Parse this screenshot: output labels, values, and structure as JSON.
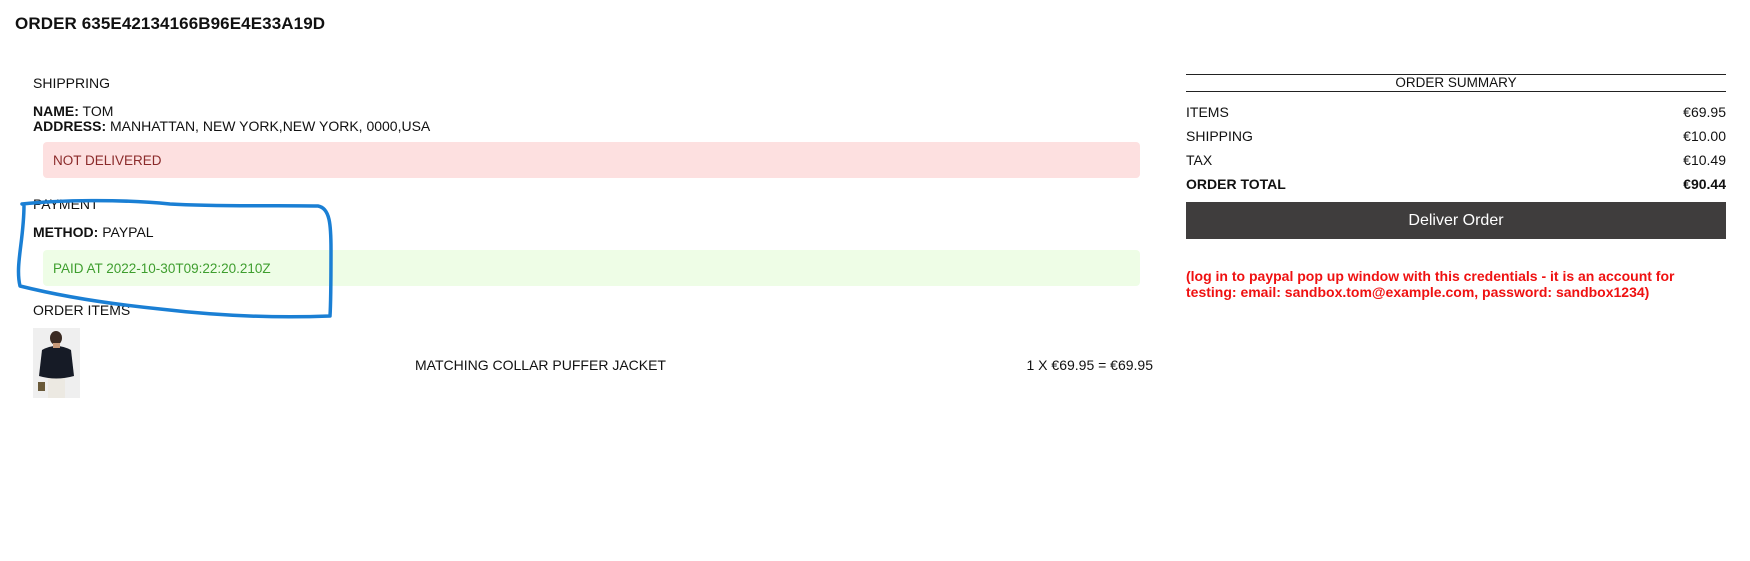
{
  "order": {
    "title": "ORDER 635E42134166B96E4E33A19D"
  },
  "shipping": {
    "heading": "SHIPPRING",
    "name_label": "NAME:",
    "name_value": "TOM",
    "address_label": "ADDRESS:",
    "address_value": "MANHATTAN, NEW YORK,NEW YORK, 0000,USA",
    "status": "NOT DELIVERED"
  },
  "payment": {
    "heading": "PAYMENT",
    "method_label": "METHOD:",
    "method_value": "PAYPAL",
    "status": "PAID AT 2022-10-30T09:22:20.210Z"
  },
  "order_items": {
    "heading": "ORDER ITEMS",
    "items": [
      {
        "name": "MATCHING COLLAR PUFFER JACKET",
        "price_line": "1 X €69.95 = €69.95"
      }
    ]
  },
  "summary": {
    "heading": "ORDER SUMMARY",
    "rows": [
      {
        "label": "ITEMS",
        "value": "€69.95"
      },
      {
        "label": "SHIPPING",
        "value": "€10.00"
      },
      {
        "label": "TAX",
        "value": "€10.49"
      },
      {
        "label": "ORDER TOTAL",
        "value": "€90.44"
      }
    ],
    "deliver_button": "Deliver Order",
    "note": "(log in to paypal pop up window with this credentials - it is an account for testing: email: sandbox.tom@example.com, password: sandbox1234)"
  },
  "colors": {
    "danger_bg": "#fde0e0",
    "success_bg": "#eefde6",
    "button_bg": "#3f3d3d",
    "note_text": "#ef1111",
    "annotation_stroke": "#1a7fd4"
  }
}
